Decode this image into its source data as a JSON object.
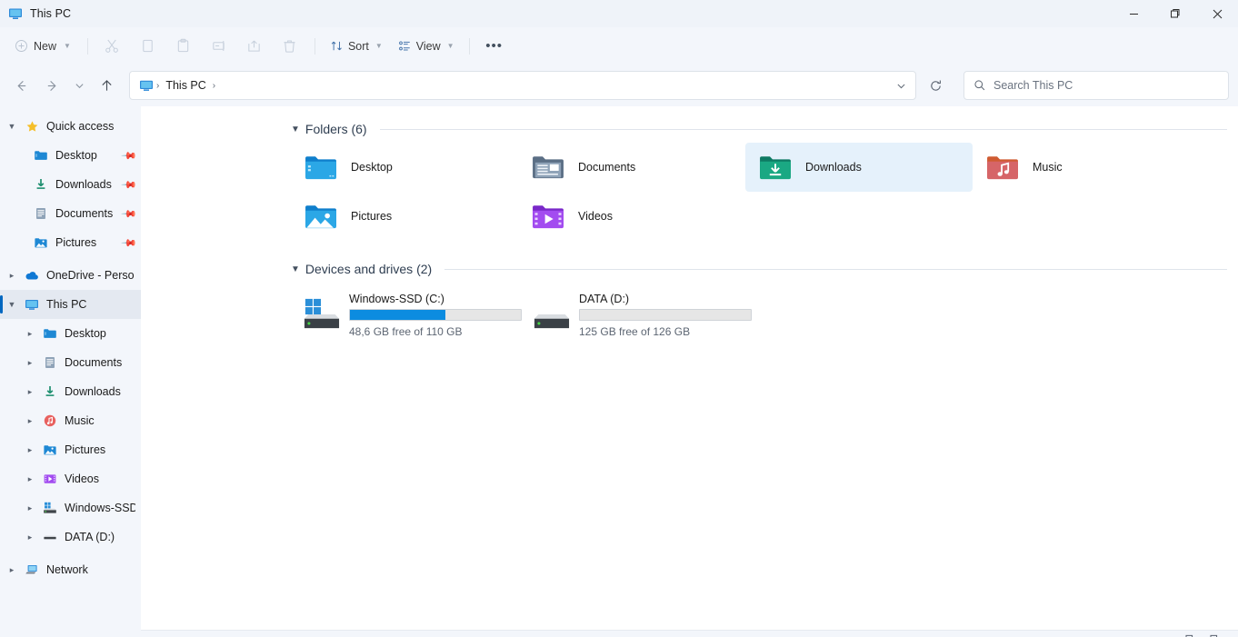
{
  "window": {
    "title": "This PC",
    "title_icon": "this-pc-monitor-icon",
    "controls": {
      "minimize": "—",
      "maximize": "❐",
      "close": "✕"
    }
  },
  "command_bar": {
    "new_label": "New",
    "new_icon": "plus-circle-icon",
    "items": [
      {
        "name": "cut",
        "icon": "scissors-icon",
        "label": "Cut"
      },
      {
        "name": "copy",
        "icon": "copy-icon",
        "label": "Copy"
      },
      {
        "name": "paste",
        "icon": "clipboard-paste-icon",
        "label": "Paste"
      },
      {
        "name": "rename",
        "icon": "rename-icon",
        "label": "Rename"
      },
      {
        "name": "share",
        "icon": "share-icon",
        "label": "Share"
      },
      {
        "name": "delete",
        "icon": "trash-icon",
        "label": "Delete"
      }
    ],
    "sort_label": "Sort",
    "sort_icon": "sort-arrows-icon",
    "view_label": "View",
    "view_icon": "view-list-icon",
    "more_label": "•••"
  },
  "address_bar": {
    "back_icon": "arrow-left-icon",
    "forward_icon": "arrow-right-icon",
    "recent_icon": "chevron-down-icon",
    "up_icon": "arrow-up-icon",
    "crumb_icon": "this-pc-monitor-icon",
    "crumbs": [
      "This PC"
    ],
    "separator": "›",
    "dropdown_icon": "chevron-down-icon",
    "refresh_icon": "refresh-icon"
  },
  "search": {
    "placeholder": "Search This PC",
    "icon": "search-icon"
  },
  "sidebar": {
    "groups": [
      {
        "name": "quick-access",
        "label": "Quick access",
        "icon": "star-icon",
        "expanded": true,
        "twisty": "⌄",
        "items": [
          {
            "label": "Desktop",
            "icon": "desktop-folder-icon",
            "pinned": true
          },
          {
            "label": "Downloads",
            "icon": "downloads-folder-icon",
            "pinned": true
          },
          {
            "label": "Documents",
            "icon": "documents-folder-icon",
            "pinned": true
          },
          {
            "label": "Pictures",
            "icon": "pictures-folder-icon",
            "pinned": true
          }
        ]
      },
      {
        "name": "onedrive",
        "label": "OneDrive - Perso",
        "icon": "onedrive-cloud-icon",
        "expanded": false,
        "twisty": "›",
        "items": []
      },
      {
        "name": "this-pc",
        "label": "This PC",
        "icon": "this-pc-monitor-icon",
        "expanded": true,
        "selected": true,
        "twisty": "⌄",
        "items": [
          {
            "label": "Desktop",
            "icon": "desktop-folder-icon",
            "twisty": "›"
          },
          {
            "label": "Documents",
            "icon": "documents-folder-icon",
            "twisty": "›"
          },
          {
            "label": "Downloads",
            "icon": "downloads-folder-icon",
            "twisty": "›"
          },
          {
            "label": "Music",
            "icon": "music-folder-icon",
            "twisty": "›"
          },
          {
            "label": "Pictures",
            "icon": "pictures-folder-icon",
            "twisty": "›"
          },
          {
            "label": "Videos",
            "icon": "videos-folder-icon",
            "twisty": "›"
          },
          {
            "label": "Windows-SSD ((",
            "icon": "windows-drive-icon",
            "twisty": "›"
          },
          {
            "label": "DATA (D:)",
            "icon": "hard-drive-icon",
            "twisty": "›"
          }
        ]
      },
      {
        "name": "network",
        "label": "Network",
        "icon": "network-icon",
        "expanded": false,
        "twisty": "›",
        "items": []
      }
    ]
  },
  "content": {
    "folders_group": {
      "title": "Folders (6)",
      "twisty": "⌄",
      "items": [
        {
          "label": "Desktop",
          "icon": "desktop-folder-icon",
          "selected": false
        },
        {
          "label": "Documents",
          "icon": "documents-folder-icon",
          "selected": false
        },
        {
          "label": "Downloads",
          "icon": "downloads-folder-icon",
          "selected": true
        },
        {
          "label": "Music",
          "icon": "music-folder-icon",
          "selected": false
        },
        {
          "label": "Pictures",
          "icon": "pictures-folder-icon",
          "selected": false
        },
        {
          "label": "Videos",
          "icon": "videos-folder-icon",
          "selected": false
        }
      ]
    },
    "drives_group": {
      "title": "Devices and drives (2)",
      "twisty": "⌄",
      "items": [
        {
          "label": "Windows-SSD (C:)",
          "icon": "windows-drive-icon",
          "free_text": "48,6 GB free of 110 GB",
          "used_percent": 56,
          "bar_color": "#0c8ce0",
          "show_bar_fill": true
        },
        {
          "label": "DATA (D:)",
          "icon": "hard-drive-icon",
          "free_text": "125 GB free of 126 GB",
          "used_percent": 1,
          "bar_color": "#0c8ce0",
          "show_bar_fill": false
        }
      ]
    }
  },
  "status_bar": {
    "view_icons": [
      "details-view-icon",
      "large-icons-view-icon"
    ]
  },
  "colors": {
    "accent": "#0067c0",
    "selection": "#e5f1fb",
    "chrome": "#f3f6fb",
    "titlebar": "#eff3f9",
    "content": "#ffffff",
    "drive_bar": "#0c8ce0"
  }
}
